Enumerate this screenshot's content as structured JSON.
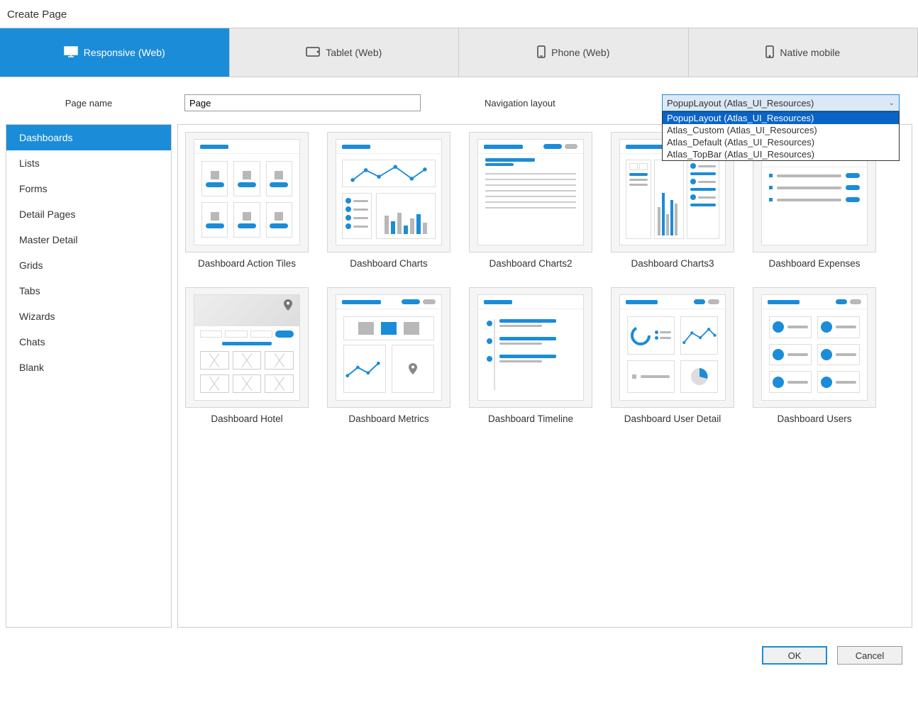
{
  "window": {
    "title": "Create Page"
  },
  "tabs": [
    {
      "label": "Responsive (Web)",
      "icon": "monitor-icon",
      "active": true
    },
    {
      "label": "Tablet (Web)",
      "icon": "tablet-icon",
      "active": false
    },
    {
      "label": "Phone (Web)",
      "icon": "phone-icon",
      "active": false
    },
    {
      "label": "Native mobile",
      "icon": "mobile-icon",
      "active": false
    }
  ],
  "form": {
    "page_name_label": "Page name",
    "page_name_value": "Page",
    "nav_layout_label": "Navigation layout",
    "nav_layout_selected": "PopupLayout (Atlas_UI_Resources)",
    "nav_layout_options": [
      "PopupLayout (Atlas_UI_Resources)",
      "Atlas_Custom (Atlas_UI_Resources)",
      "Atlas_Default (Atlas_UI_Resources)",
      "Atlas_TopBar (Atlas_UI_Resources)"
    ]
  },
  "sidebar": {
    "categories": [
      "Dashboards",
      "Lists",
      "Forms",
      "Detail Pages",
      "Master Detail",
      "Grids",
      "Tabs",
      "Wizards",
      "Chats",
      "Blank"
    ],
    "active_index": 0
  },
  "templates": [
    {
      "label": "Dashboard Action Tiles"
    },
    {
      "label": "Dashboard Charts"
    },
    {
      "label": "Dashboard Charts2"
    },
    {
      "label": "Dashboard Charts3"
    },
    {
      "label": "Dashboard Expenses"
    },
    {
      "label": "Dashboard Hotel"
    },
    {
      "label": "Dashboard Metrics"
    },
    {
      "label": "Dashboard Timeline"
    },
    {
      "label": "Dashboard User Detail"
    },
    {
      "label": "Dashboard Users"
    }
  ],
  "footer": {
    "ok": "OK",
    "cancel": "Cancel"
  }
}
